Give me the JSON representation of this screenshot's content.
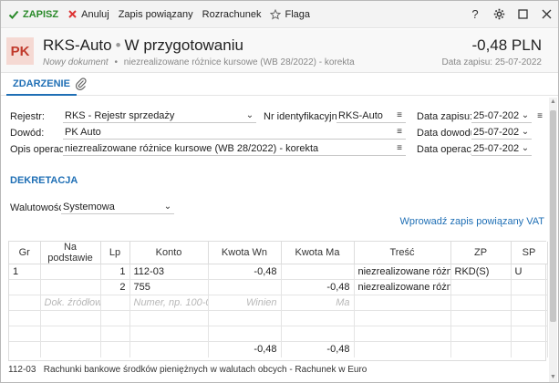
{
  "toolbar": {
    "save": "ZAPISZ",
    "cancel": "Anuluj",
    "linked": "Zapis powiązany",
    "settlement": "Rozrachunek",
    "flag": "Flaga"
  },
  "header": {
    "badge": "PK",
    "title": "RKS-Auto",
    "status": "W przygotowaniu",
    "subtitle_new": "Nowy dokument",
    "subtitle_desc": "niezrealizowane różnice kursowe (WB 28/2022) - korekta",
    "amount": "-0,48 PLN",
    "date_line": "Data zapisu: 25-07-2022"
  },
  "tabs": {
    "event": "ZDARZENIE"
  },
  "form": {
    "rejestr_label": "Rejestr:",
    "rejestr_value": "RKS - Rejestr sprzedaży",
    "nrid_label": "Nr identyfikacyjny:",
    "nrid_value": "RKS-Auto",
    "data_zapisu_label": "Data zapisu:",
    "data_zapisu_value": "25-07-2022",
    "dowod_label": "Dowód:",
    "dowod_value": "PK Auto",
    "data_dowodu_label": "Data dowodu:",
    "data_dowodu_value": "25-07-2022",
    "opis_label": "Opis operacji:",
    "opis_value": "niezrealizowane różnice kursowe (WB 28/2022) - korekta",
    "data_operacji_label": "Data operacji:",
    "data_operacji_value": "25-07-2022"
  },
  "dekretacja": {
    "title": "DEKRETACJA",
    "waluta_label": "Walutowość:",
    "waluta_value": "Systemowa",
    "vat_link": "Wprowadź zapis powiązany VAT"
  },
  "table": {
    "headers": {
      "gr": "Gr",
      "podstawie": "Na podstawie",
      "lp": "Lp",
      "konto": "Konto",
      "wn": "Kwota Wn",
      "ma": "Kwota Ma",
      "tresc": "Treść",
      "zp": "ZP",
      "sp": "SP"
    },
    "rows": [
      {
        "gr": "1",
        "podstawie": "",
        "lp": "1",
        "konto": "112-03",
        "wn": "-0,48",
        "ma": "",
        "tresc": "niezrealizowane różni...",
        "zp": "RKD(S)",
        "sp": "U"
      },
      {
        "gr": "",
        "podstawie": "",
        "lp": "2",
        "konto": "755",
        "wn": "",
        "ma": "-0,48",
        "tresc": "niezrealizowane różni...",
        "zp": "",
        "sp": ""
      }
    ],
    "placeholder": {
      "podstawie": "Dok. źródłowy",
      "konto": "Numer, np. 100-01",
      "wn": "Winien",
      "ma": "Ma"
    },
    "sum_wn": "-0,48",
    "sum_ma": "-0,48"
  },
  "footer": {
    "note": "112-03   Rachunki bankowe środków pieniężnych w walutach obcych - Rachunek w Euro"
  },
  "colors": {
    "accent": "#1f6fb5",
    "save": "#2a8a2a",
    "cancel": "#d33",
    "badge_bg": "#f5d9d3",
    "badge_fg": "#c0392b"
  }
}
